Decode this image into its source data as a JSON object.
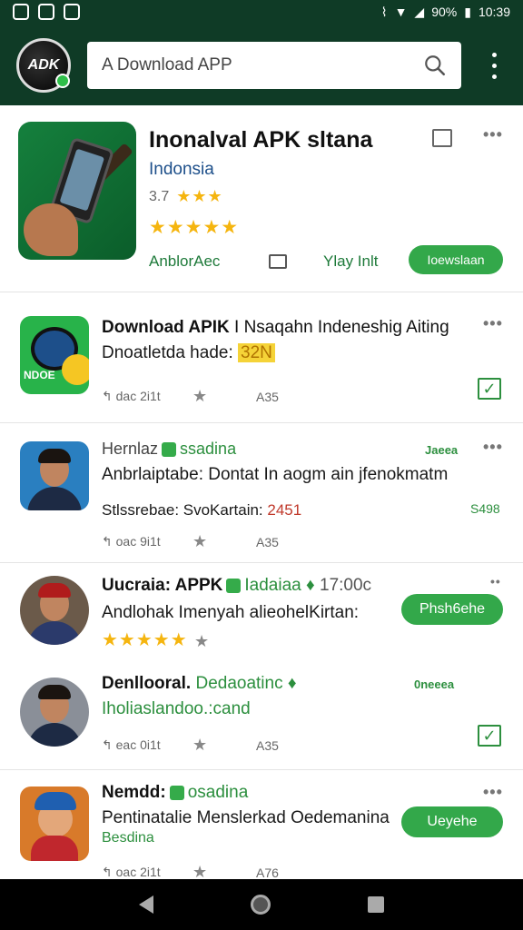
{
  "status": {
    "battery": "90%",
    "time": "10:39"
  },
  "app": {
    "logo_text": "ADK"
  },
  "search": {
    "placeholder": "A Download APP"
  },
  "featured": {
    "title": "Inonalval APK sltana",
    "subtitle": "Indonsia",
    "rating_value": "3.7",
    "developer": "AnblorAec",
    "play_label": "Ylay Inlt",
    "button_label": "Ioewslaan"
  },
  "items": [
    {
      "title_bold": "Download APIK",
      "title_rest": "I Nsaqahn Indeneshig Aiting",
      "line2": "Dnoatletda hade:",
      "line2_hl": "32N",
      "meta_a": "dac 2i1t",
      "meta_b": "A35"
    },
    {
      "title": "Hernlaz",
      "tag_text": "ssadina",
      "side": "Jaeea",
      "line2": "Anbrlaiptabe: Dontat In aogm ain jfenokmatm",
      "line3": "Stlssrebae: SvoKartain:",
      "line3_red": "2451",
      "price": "S498",
      "meta_a": "oac 9i1t",
      "meta_b": "A35"
    },
    {
      "title": "Uucraia: APPK",
      "tag_text": "Iadaiaa",
      "time": "17:00c",
      "line2": "Andlohak Imenyah alieohelKirtan:",
      "button_label": "Phsh6ehe"
    },
    {
      "title": "Denllooral.",
      "green_text": "Dedaoatinc",
      "side": "0neeea",
      "line2": "Iholiaslandoo.:cand",
      "meta_a": "eac 0i1t",
      "meta_b": "A35"
    },
    {
      "title": "Nemdd:",
      "tag_text": "osadina",
      "line2": "Pentinatalie Menslerkad Oedemanina",
      "line3": "Besdina",
      "button_label": "Ueyehe",
      "meta_a": "oac 2i1t",
      "meta_b": "A76"
    }
  ],
  "colors": {
    "appbar": "#0f3b26",
    "accent": "#33a84a",
    "star": "#f5b50f"
  }
}
